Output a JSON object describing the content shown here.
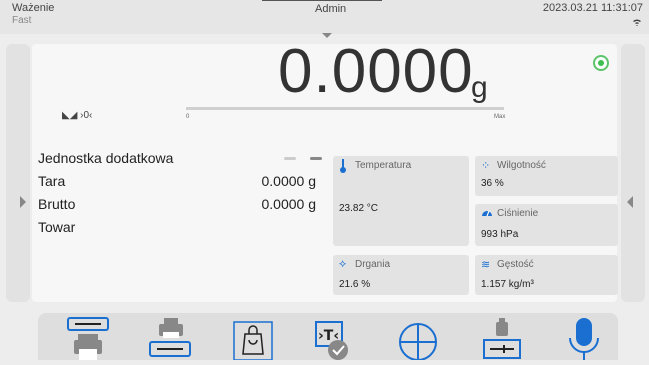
{
  "header": {
    "mode": "Ważenie",
    "submode": "Fast",
    "user": "Admin",
    "datetime": "2023.03.21 11:31:07",
    "wifi_icon": "wifi-icon"
  },
  "weighing": {
    "value": "0.0000",
    "unit": "g",
    "indicators": "◣◢ ›0‹",
    "bar_min": "0",
    "bar_max": "Max",
    "stability_color": "#3bbf4f"
  },
  "info": {
    "rows": [
      {
        "label": "Jednostka dodatkowa",
        "value": ""
      },
      {
        "label": "Tara",
        "value": "0.0000 g"
      },
      {
        "label": "Brutto",
        "value": "0.0000 g"
      },
      {
        "label": "Towar",
        "value": ""
      }
    ]
  },
  "tiles": {
    "temperature": {
      "title": "Temperatura",
      "value": "23.82 °C",
      "icon": "thermometer-icon"
    },
    "humidity": {
      "title": "Wilgotność",
      "value": "36 %",
      "icon": "humidity-icon"
    },
    "pressure": {
      "title": "Ciśnienie",
      "value": "993 hPa",
      "icon": "gauge-icon"
    },
    "vibration": {
      "title": "Drgania",
      "value": "21.6 %",
      "icon": "vibration-icon"
    },
    "density": {
      "title": "Gęstość",
      "value": "1.157 kg/m³",
      "icon": "density-icon"
    }
  },
  "toolbar": {
    "buttons": [
      "print-header-icon",
      "print-footer-icon",
      "product-bag-icon",
      "tare-icon",
      "database-icon",
      "adjustment-weight-icon",
      "microphone-icon"
    ]
  },
  "colors": {
    "accent": "#1a6fd1",
    "background": "#ededed",
    "panel": "#f7f7f7",
    "tile": "#e3e3e3"
  }
}
